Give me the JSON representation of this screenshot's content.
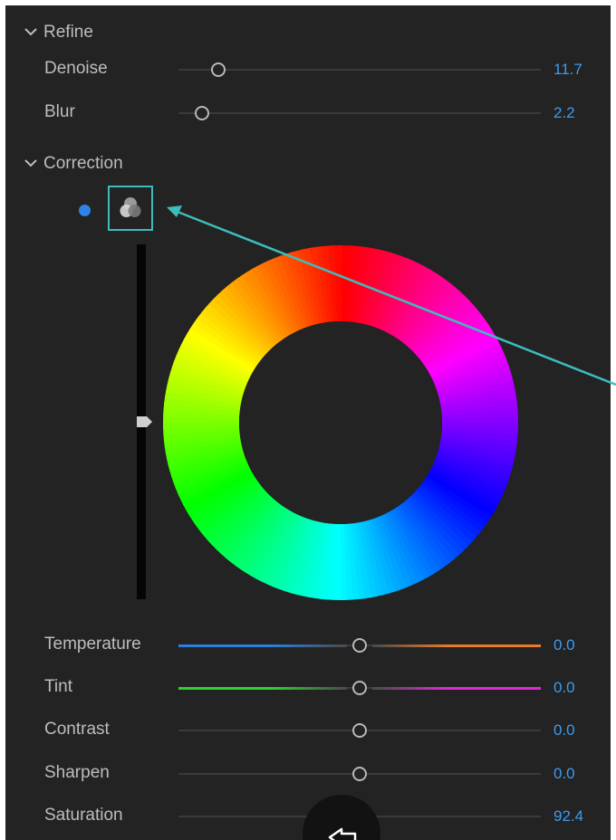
{
  "sections": {
    "refine": {
      "title": "Refine"
    },
    "correction": {
      "title": "Correction"
    }
  },
  "refine_rows": [
    {
      "label": "Denoise",
      "value": "11.7",
      "position": 0.11
    },
    {
      "label": "Blur",
      "value": "2.2",
      "position": 0.065
    }
  ],
  "correction_rows": [
    {
      "label": "Temperature",
      "value": "0.0",
      "position": 0.5,
      "left_color": "#2d7fe0",
      "right_color": "#e97a2c"
    },
    {
      "label": "Tint",
      "value": "0.0",
      "position": 0.5,
      "left_color": "#2fd12f",
      "right_color": "#e02ad6"
    },
    {
      "label": "Contrast",
      "value": "0.0",
      "position": 0.5
    },
    {
      "label": "Sharpen",
      "value": "0.0",
      "position": 0.5
    },
    {
      "label": "Saturation",
      "value": "92.4",
      "position": 0.462
    }
  ],
  "luminance_level": 0.5,
  "colors": {
    "panel_bg": "#232323",
    "accent_value": "#3d9bef",
    "highlight_box": "#3ebcbc",
    "dot": "#2e83e6"
  },
  "icons": {
    "mode_icon": "color-components-icon",
    "bottom_button_icon": "back-arrow-icon"
  }
}
